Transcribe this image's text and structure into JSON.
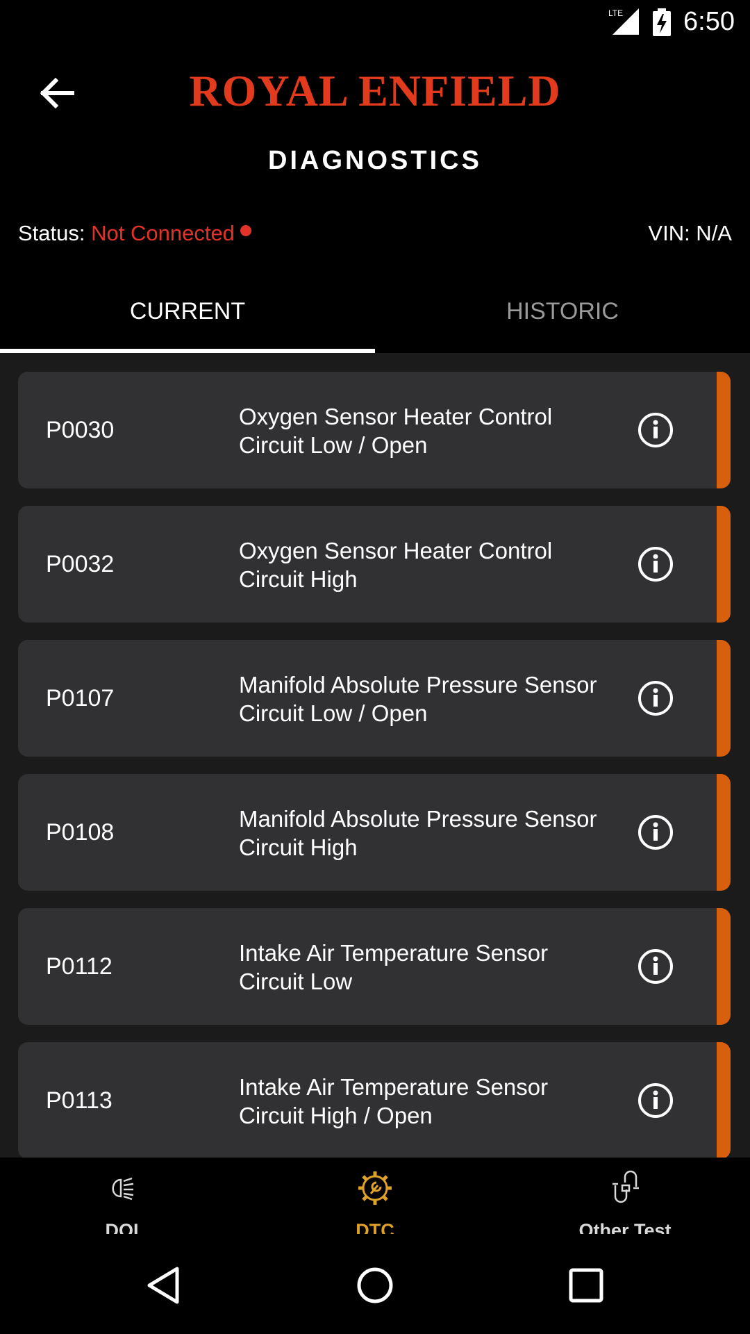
{
  "status_bar": {
    "network": "LTE",
    "time": "6:50"
  },
  "app_bar": {
    "brand": "ROYAL ENFIELD",
    "title": "DIAGNOSTICS",
    "back_icon": "arrow-left-icon"
  },
  "connection": {
    "label": "Status:",
    "value": "Not Connected",
    "vin": "VIN: N/A"
  },
  "tabs": [
    {
      "label": "CURRENT",
      "active": true
    },
    {
      "label": "HISTORIC",
      "active": false
    }
  ],
  "dtc_list": [
    {
      "code": "P0030",
      "line1": "Oxygen Sensor Heater Control",
      "line2": "Circuit Low / Open"
    },
    {
      "code": "P0032",
      "line1": "Oxygen Sensor Heater Control",
      "line2": "Circuit High"
    },
    {
      "code": "P0107",
      "line1": "Manifold Absolute Pressure Sensor",
      "line2": "Circuit Low / Open"
    },
    {
      "code": "P0108",
      "line1": "Manifold Absolute Pressure Sensor",
      "line2": "Circuit High"
    },
    {
      "code": "P0112",
      "line1": "Intake Air Temperature Sensor",
      "line2": "Circuit Low"
    },
    {
      "code": "P0113",
      "line1": "Intake Air Temperature Sensor",
      "line2": "Circuit High / Open"
    }
  ],
  "bottom_nav": [
    {
      "label": "DOL",
      "icon": "headlight-icon",
      "active": false
    },
    {
      "label": "DTC",
      "icon": "gear-wrench-icon",
      "active": true
    },
    {
      "label": "Other Test",
      "icon": "connector-icon",
      "active": false
    }
  ],
  "colors": {
    "accent": "#d75f0e",
    "brand": "#e23a1c",
    "disconnected": "#e2332b",
    "active_nav": "#e0a12a"
  }
}
